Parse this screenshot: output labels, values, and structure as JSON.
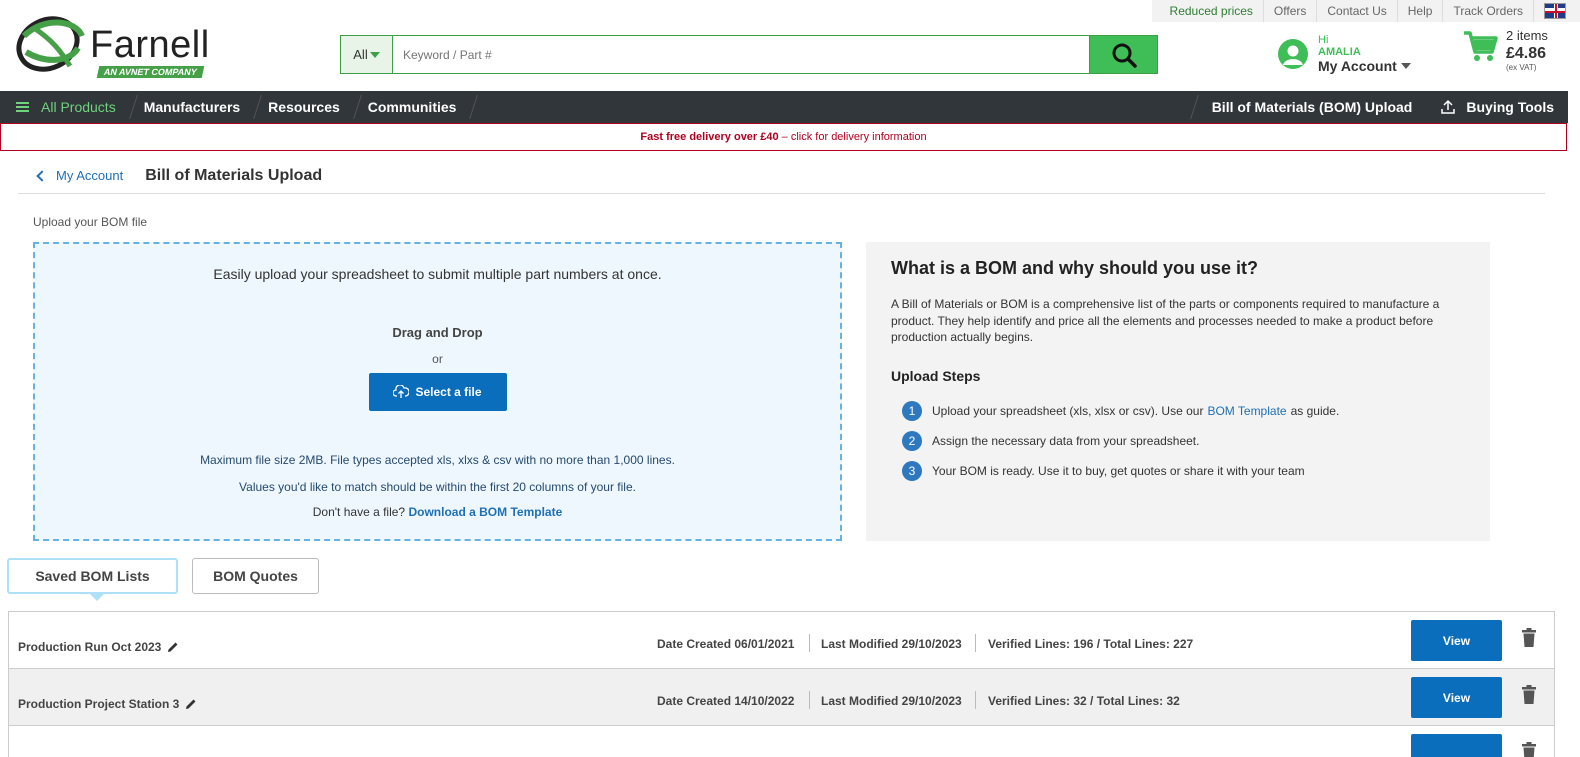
{
  "util_nav": {
    "reduced": "Reduced prices",
    "offers": "Offers",
    "contact": "Contact Us",
    "help": "Help",
    "track": "Track Orders"
  },
  "logo": {
    "brand": "Farnell",
    "tag": "AN AVNET COMPANY"
  },
  "search": {
    "category": "All",
    "placeholder": "Keyword / Part #"
  },
  "account": {
    "hi": "Hi",
    "name": "AMALIA",
    "label": "My Account"
  },
  "cart": {
    "items": "2 items",
    "price": "£4.86",
    "vat": "(ex VAT)"
  },
  "nav": {
    "all": "All Products",
    "manufacturers": "Manufacturers",
    "resources": "Resources",
    "communities": "Communities",
    "bom": "Bill of Materials (BOM) Upload",
    "buying": "Buying Tools"
  },
  "promo": {
    "bold": "Fast free delivery over £40",
    "rest": " – click for delivery information"
  },
  "breadcrumb": {
    "back": "My Account",
    "title": "Bill of Materials Upload"
  },
  "upload": {
    "label": "Upload your BOM file",
    "lead": "Easily upload your spreadsheet to submit multiple part numbers at once.",
    "drag": "Drag and Drop",
    "or": "or",
    "select": "Select a file",
    "note1": "Maximum file size 2MB. File types accepted xls, xlxs & csv with no more than 1,000 lines.",
    "note2": "Values you'd like to match should be within the first 20 columns of your file.",
    "note3": "Don't have a file?",
    "template_link": "Download a BOM Template"
  },
  "info": {
    "title": "What is a BOM and why should you use it?",
    "desc": "A Bill of Materials or BOM is a comprehensive list of the parts or components required to manufacture a product. They help identify and price all the elements and processes needed to make a product before production actually begins.",
    "steps_title": "Upload Steps",
    "step1_pre": "Upload your spreadsheet (xls, xlsx or csv). Use our",
    "step1_link": "BOM Template",
    "step1_post": "as guide.",
    "step2": "Assign the necessary data from your spreadsheet.",
    "step3": "Your BOM is ready. Use it to buy, get quotes or share it with your team"
  },
  "tabs": {
    "saved": "Saved BOM Lists",
    "quotes": "BOM Quotes"
  },
  "bom_lists": [
    {
      "name": "Production Run Oct 2023",
      "created": "Date Created 06/01/2021",
      "modified": "Last Modified 29/10/2023",
      "lines": "Verified Lines: 196 / Total Lines: 227",
      "view": "View"
    },
    {
      "name": "Production Project Station 3",
      "created": "Date Created 14/10/2022",
      "modified": "Last Modified 29/10/2023",
      "lines": "Verified Lines: 32 / Total Lines: 32",
      "view": "View"
    }
  ],
  "colors": {
    "green": "#3fbd57",
    "blue": "#0a6ebd",
    "nav": "#31363a",
    "promo": "#b00020"
  }
}
